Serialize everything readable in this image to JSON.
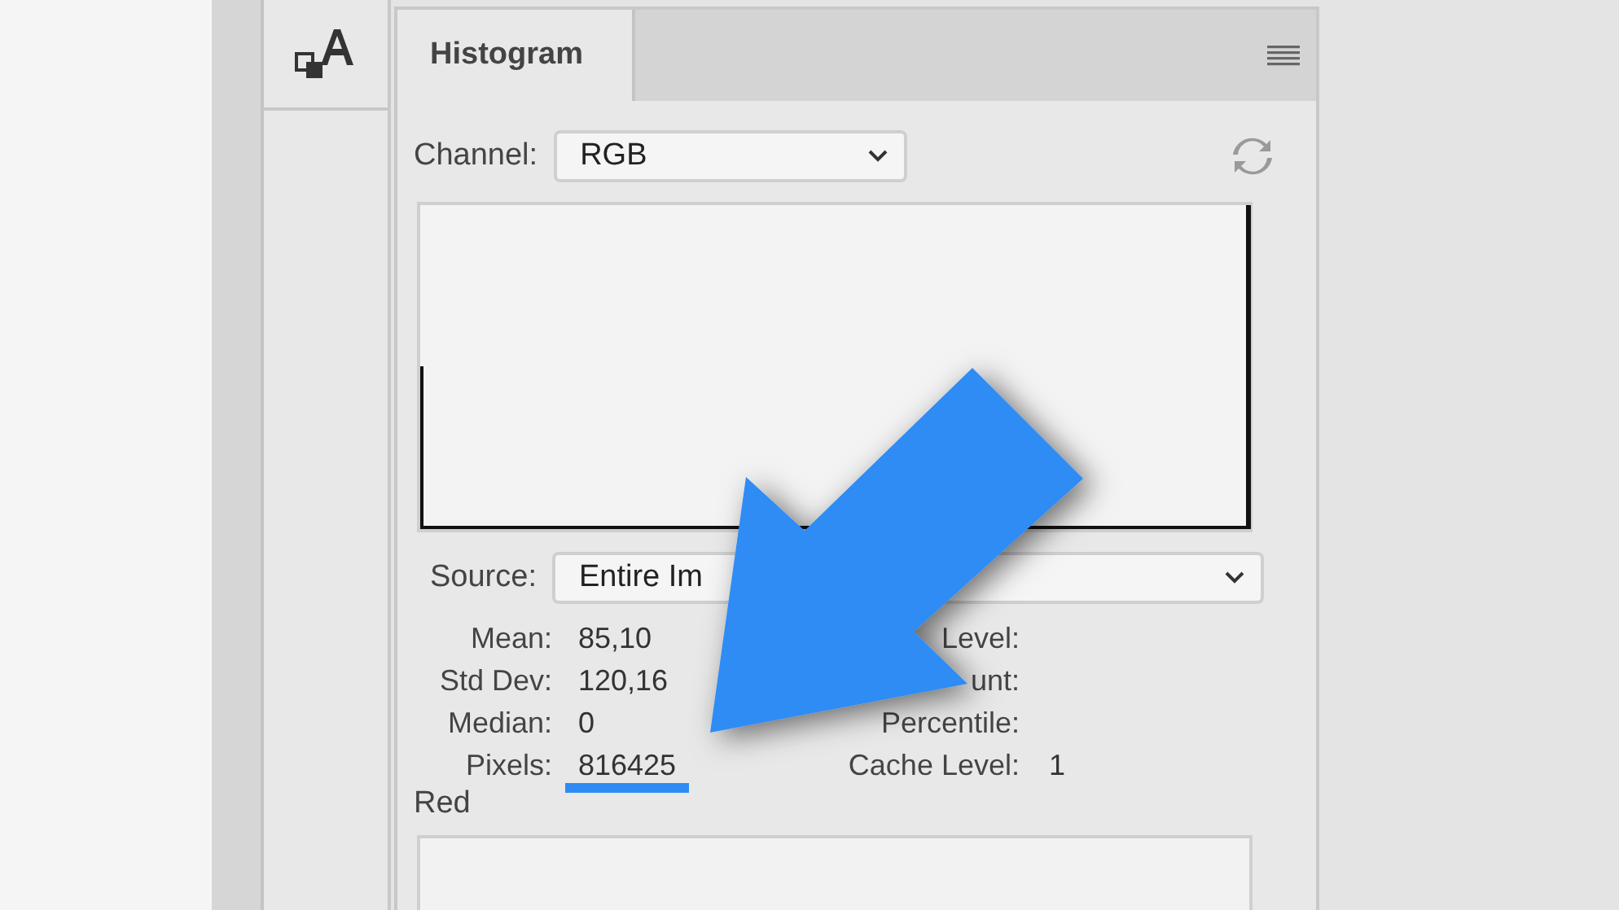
{
  "panel": {
    "tab": {
      "label": "Histogram",
      "selected": true
    },
    "channel": {
      "label": "Channel:",
      "value": "RGB"
    },
    "source": {
      "label": "Source:",
      "value": "Entire Im"
    },
    "stats_left": [
      {
        "label": "Mean:",
        "value": "85,10",
        "highlighted": false
      },
      {
        "label": "Std Dev:",
        "value": "120,16",
        "highlighted": false
      },
      {
        "label": "Median:",
        "value": "0",
        "highlighted": false
      },
      {
        "label": "Pixels:",
        "value": "816425",
        "highlighted": true
      }
    ],
    "stats_right": [
      {
        "label": "Level:"
      },
      {
        "label": "unt:"
      },
      {
        "label": "Percentile:"
      },
      {
        "label": "Cache Level:",
        "value": "1"
      }
    ],
    "red_label": "Red"
  }
}
